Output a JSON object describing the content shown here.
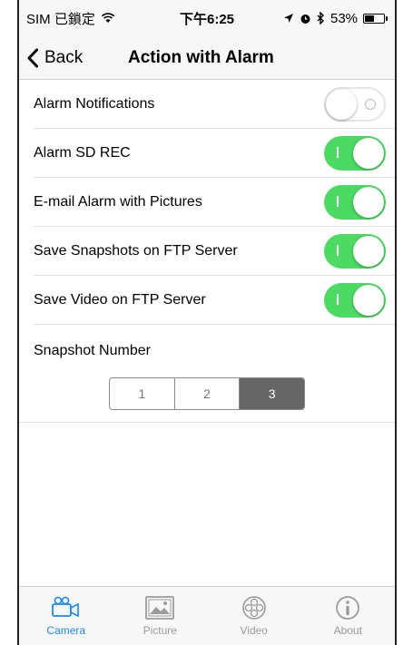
{
  "status_bar": {
    "carrier": "SIM 已鎖定",
    "time": "下午6:25",
    "battery_percent_text": "53%",
    "battery_level": 0.53
  },
  "nav": {
    "back_label": "Back",
    "title": "Action with Alarm"
  },
  "settings": [
    {
      "label": "Alarm Notifications",
      "enabled": false
    },
    {
      "label": "Alarm SD REC",
      "enabled": true
    },
    {
      "label": "E-mail Alarm with Pictures",
      "enabled": true
    },
    {
      "label": "Save Snapshots on FTP Server",
      "enabled": true
    },
    {
      "label": "Save Video on FTP Server",
      "enabled": true
    }
  ],
  "snapshot": {
    "label": "Snapshot Number",
    "options": [
      "1",
      "2",
      "3"
    ],
    "selected": "3"
  },
  "tabbar": {
    "tabs": [
      {
        "label": "Camera",
        "icon": "camera-icon",
        "active": true
      },
      {
        "label": "Picture",
        "icon": "picture-icon",
        "active": false
      },
      {
        "label": "Video",
        "icon": "video-icon",
        "active": false
      },
      {
        "label": "About",
        "icon": "info-icon",
        "active": false
      }
    ]
  },
  "colors": {
    "switch_on": "#4cd964",
    "tab_active": "#1e88e5",
    "tab_inactive": "#9a9a9a",
    "segment_selected": "#666666"
  }
}
